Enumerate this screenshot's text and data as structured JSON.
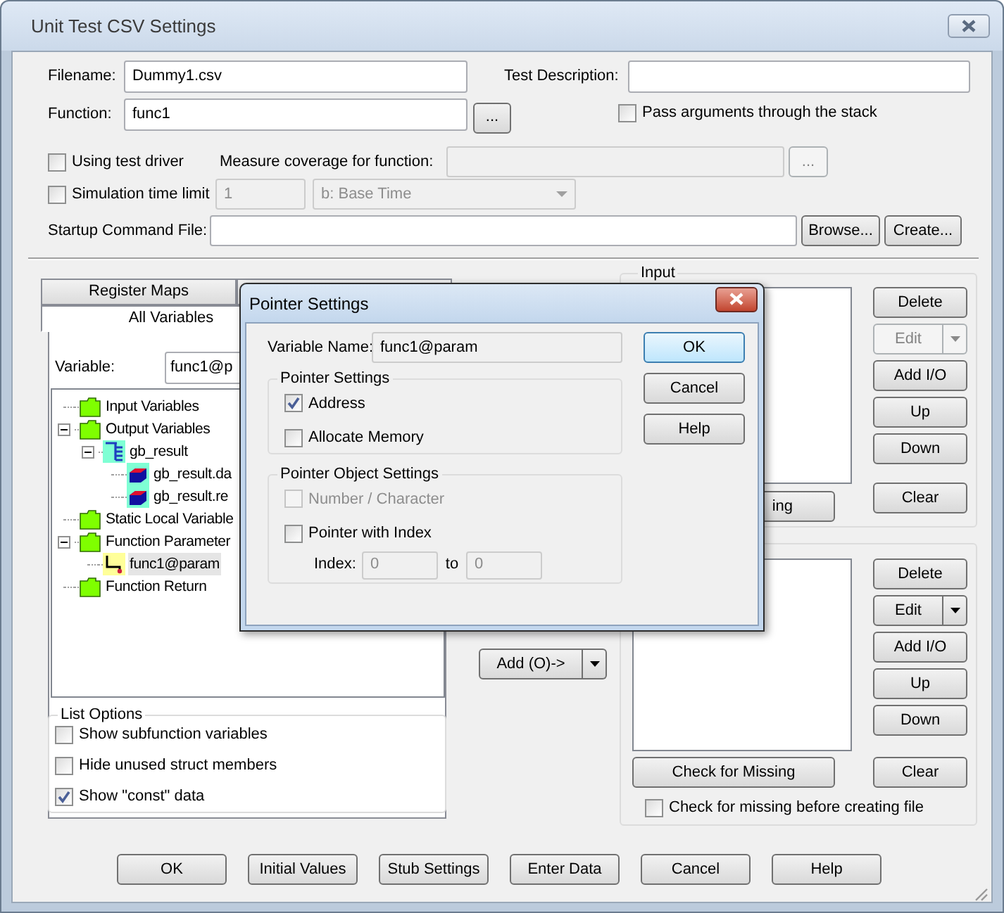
{
  "window": {
    "title": "Unit Test CSV Settings"
  },
  "form": {
    "filename_label": "Filename:",
    "filename": "Dummy1.csv",
    "description_label": "Test Description:",
    "function_label": "Function:",
    "function": "func1",
    "function_browse": "...",
    "pass_stack": {
      "label": "Pass arguments through the stack",
      "checked": false
    },
    "test_driver": {
      "label": "Using test driver",
      "checked": false
    },
    "coverage_label": "Measure coverage for function:",
    "coverage_browse": {
      "label": "...",
      "disabled": true
    },
    "time_limit": {
      "label": "Simulation time limit",
      "checked": false
    },
    "time_value": "1",
    "time_unit": "b: Base Time",
    "startup_label": "Startup Command File:",
    "browse": "Browse...",
    "create": "Create..."
  },
  "tabs": [
    [
      {
        "label": "Register Maps",
        "selected": false
      },
      {
        "selected": false
      }
    ],
    [
      {
        "label": "All Variables",
        "selected": true
      }
    ]
  ],
  "variable_label": "Variable:",
  "variable": "func1@p",
  "tree": [
    {
      "label": "Input Variables",
      "kind": "folder",
      "selected": false
    },
    {
      "label": "Output Variables",
      "kind": "folder",
      "selected": false,
      "expanded": true,
      "children": [
        {
          "label": "gb_result",
          "kind": "struct",
          "selected": false,
          "expanded": true,
          "children": [
            {
              "label": "gb_result.da",
              "kind": "member",
              "selected": false
            },
            {
              "label": "gb_result.re",
              "kind": "member",
              "selected": false
            }
          ]
        }
      ]
    },
    {
      "label": "Static Local Variable",
      "kind": "folder",
      "selected": false
    },
    {
      "label": "Function Parameter",
      "kind": "folder",
      "selected": false,
      "expanded": true,
      "children": [
        {
          "label": "func1@param",
          "kind": "pointer",
          "selected": true
        }
      ]
    },
    {
      "label": "Function Return",
      "kind": "folder",
      "selected": false
    }
  ],
  "list_options": {
    "title": "List Options",
    "options": [
      {
        "label": "Show subfunction variables",
        "checked": false
      },
      {
        "label": "Hide unused struct members",
        "checked": false
      },
      {
        "label": "Show \"const\" data",
        "checked": true
      }
    ]
  },
  "add_button": "Add (O)->",
  "input_group": {
    "title": "Input",
    "check_missing": "ing",
    "buttons": [
      {
        "label": "Delete",
        "kind": "button",
        "disabled": false
      },
      {
        "label": "Edit",
        "kind": "split",
        "disabled": true
      },
      {
        "label": "Add I/O",
        "kind": "button",
        "disabled": false
      },
      {
        "label": "Up",
        "kind": "button",
        "disabled": false
      },
      {
        "label": "Down",
        "kind": "button",
        "disabled": false
      }
    ],
    "clear": "Clear"
  },
  "output_group": {
    "check_missing": "Check for Missing",
    "buttons": [
      {
        "label": "Delete",
        "kind": "button",
        "disabled": false
      },
      {
        "label": "Edit",
        "kind": "split",
        "disabled": false
      },
      {
        "label": "Add I/O",
        "kind": "button",
        "disabled": false
      },
      {
        "label": "Up",
        "kind": "button",
        "disabled": false
      },
      {
        "label": "Down",
        "kind": "button",
        "disabled": false
      }
    ],
    "clear": "Clear",
    "check_before": {
      "label": "Check for missing before creating file",
      "checked": false
    }
  },
  "footer_buttons": [
    "OK",
    "Initial Values",
    "Stub Settings",
    "Enter Data",
    "Cancel",
    "Help"
  ],
  "dialog": {
    "title": "Pointer Settings",
    "name_label": "Variable Name:",
    "name": "func1@param",
    "group1": {
      "title": "Pointer Settings",
      "options": [
        {
          "label": "Address",
          "checked": true,
          "disabled": false
        },
        {
          "label": "Allocate Memory",
          "checked": false,
          "disabled": false
        }
      ]
    },
    "group2": {
      "title": "Pointer Object Settings",
      "options": [
        {
          "label": "Number / Character",
          "checked": false,
          "disabled": true
        },
        {
          "label": "Pointer with Index",
          "checked": false,
          "disabled": false
        }
      ],
      "index_label": "Index:",
      "index_from": "0",
      "to_label": "to",
      "index_to": "0"
    },
    "buttons": [
      {
        "label": "OK",
        "default": true
      },
      {
        "label": "Cancel",
        "default": false
      },
      {
        "label": "Help",
        "default": false
      }
    ]
  }
}
